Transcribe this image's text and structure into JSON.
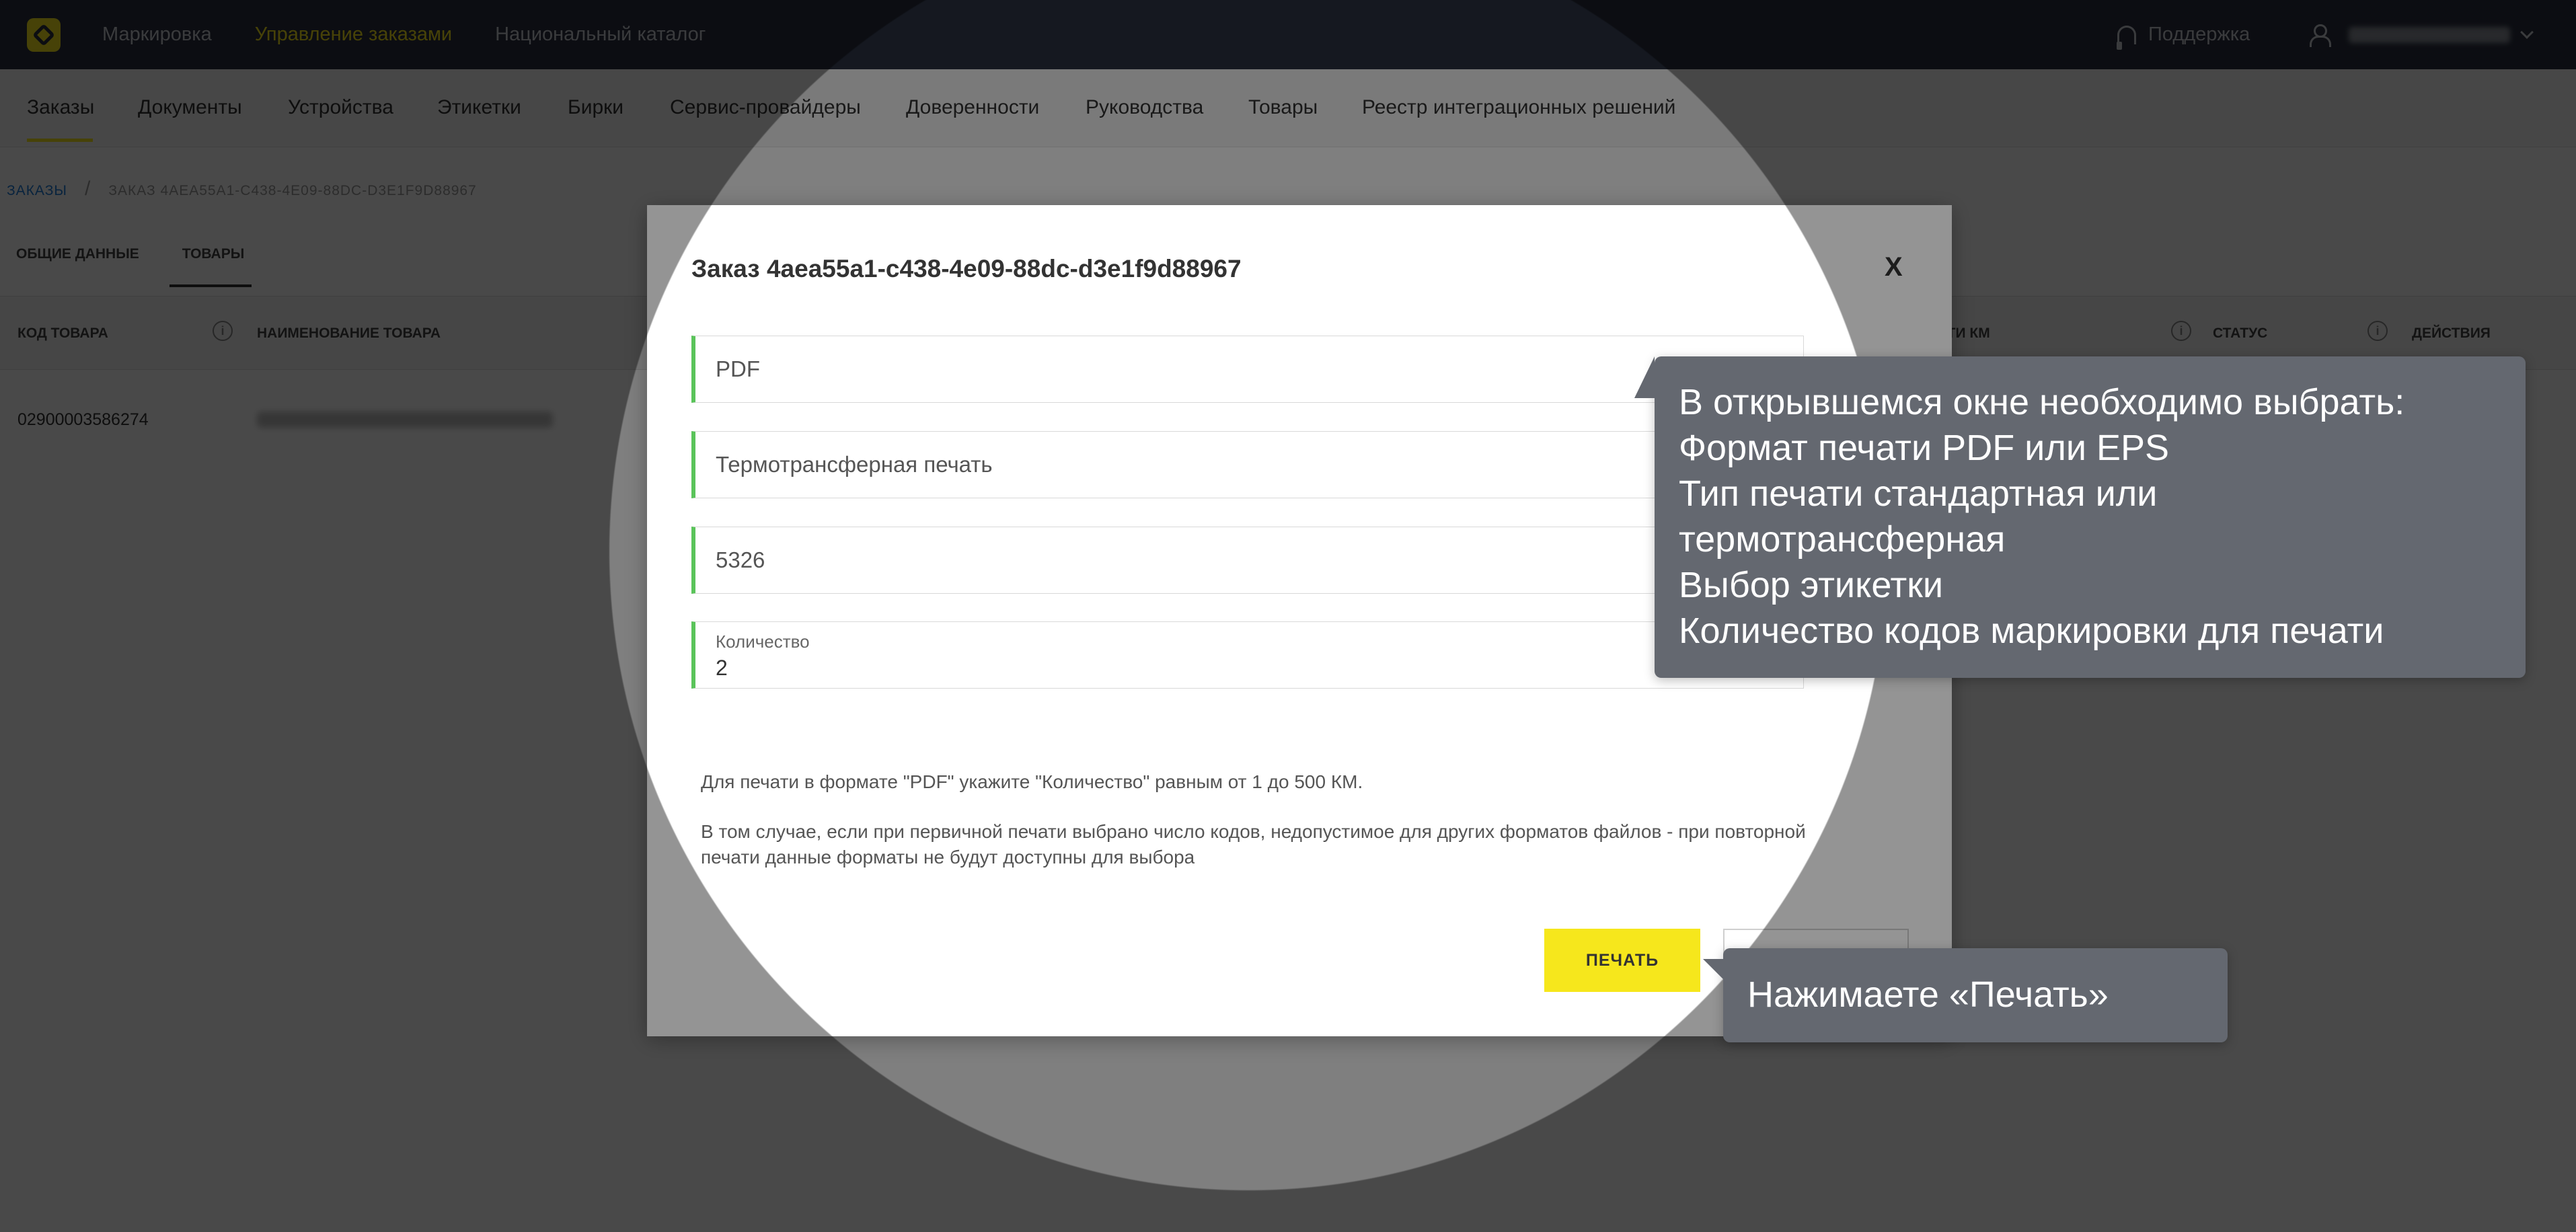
{
  "header": {
    "nav": [
      "Маркировка",
      "Управление заказами",
      "Национальный каталог"
    ],
    "active_index": 1,
    "support_label": "Поддержка"
  },
  "subnav": {
    "items": [
      "Заказы",
      "Документы",
      "Устройства",
      "Этикетки",
      "Бирки",
      "Сервис-провайдеры",
      "Доверенности",
      "Руководства",
      "Товары",
      "Реестр интеграционных решений"
    ],
    "active_index": 0
  },
  "breadcrumb": {
    "root": "ЗАКАЗЫ",
    "separator": "/",
    "current": "ЗАКАЗ 4AEA55A1-C438-4E09-88DC-D3E1F9D88967"
  },
  "order_tabs": [
    "ОБЩИЕ ДАННЫЕ",
    "ТОВАРЫ"
  ],
  "table": {
    "columns": [
      "КОД ТОВАРА",
      "НАИМЕНОВАНИЕ ТОВАРА",
      "СТИ КМ",
      "СТАТУС",
      "ДЕЙСТВИЯ"
    ],
    "rows": [
      {
        "code": "02900003586274"
      }
    ]
  },
  "modal": {
    "title": "Заказ 4aea55a1-c438-4e09-88dc-d3e1f9d88967",
    "close": "X",
    "format_value": "PDF",
    "print_type_value": "Термотрансферная печать",
    "template_value": "5326",
    "quantity_label": "Количество",
    "quantity_value": "2",
    "hint_1": "Для печати в формате \"PDF\" укажите \"Количество\" равным от 1 до 500 КМ.",
    "hint_2_line1": "В том случае, если при первичной печати выбрано число кодов, недопустимое для других форматов файлов - при повторной",
    "hint_2_line2": "печати данные форматы не будут доступны для выбора",
    "print_label": "ПЕЧАТЬ"
  },
  "tooltips": {
    "main_lines": [
      "В открывшемся окне необходимо выбрать:",
      "Формат печати PDF или EPS",
      "Тип печати стандартная или",
      "термотрансферная",
      "Выбор этикетки",
      "Количество кодов маркировки для печати"
    ],
    "print_hint": "Нажимаете «Печать»"
  },
  "colors": {
    "accent": "#f6e71c",
    "header_bg": "#2b3040",
    "field_marker": "#5ac45a",
    "tooltip_bg": "#646870",
    "link": "#1d7bd6"
  }
}
